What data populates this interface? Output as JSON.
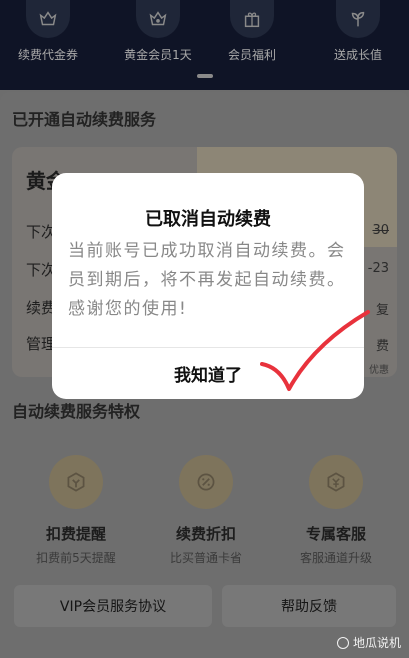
{
  "perks": [
    {
      "label": "续费代金券",
      "icon": "coupon-crown-icon"
    },
    {
      "label": "黄金会员1天",
      "icon": "crown-icon"
    },
    {
      "label": "会员福利",
      "icon": "gift-box-icon"
    },
    {
      "label": "送成长值",
      "icon": "sprout-icon"
    }
  ],
  "section_auto_renew": {
    "title": "已开通自动续费服务"
  },
  "card": {
    "title": "黄金",
    "rows": [
      {
        "label": "下次",
        "value": "30",
        "strike": true
      },
      {
        "label": "下次",
        "value": "-23"
      },
      {
        "label": "续费",
        "value": "复"
      },
      {
        "label": "管理",
        "value": "费"
      }
    ],
    "note": "优惠"
  },
  "section_privileges": {
    "title": "自动续费服务特权"
  },
  "privileges": [
    {
      "title": "扣费提醒",
      "subtitle": "扣费前5天提醒",
      "icon": "bell-coin-icon"
    },
    {
      "title": "续费折扣",
      "subtitle": "比买普通卡省",
      "icon": "discount-badge-icon"
    },
    {
      "title": "专属客服",
      "subtitle": "客服通道升级",
      "icon": "headset-coin-icon"
    }
  ],
  "bottom_buttons": {
    "agreement": "VIP会员服务协议",
    "help": "帮助反馈"
  },
  "watermark": {
    "text": "地瓜说机"
  },
  "modal": {
    "title": "已取消自动续费",
    "body": "当前账号已成功取消自动续费。会员到期后，将不再发起自动续费。感谢您的使用!",
    "button": "我知道了"
  },
  "colors": {
    "accent_check": "#e8323c",
    "dim_overlay": "#6e6e6e",
    "banner": "#0f1426"
  }
}
